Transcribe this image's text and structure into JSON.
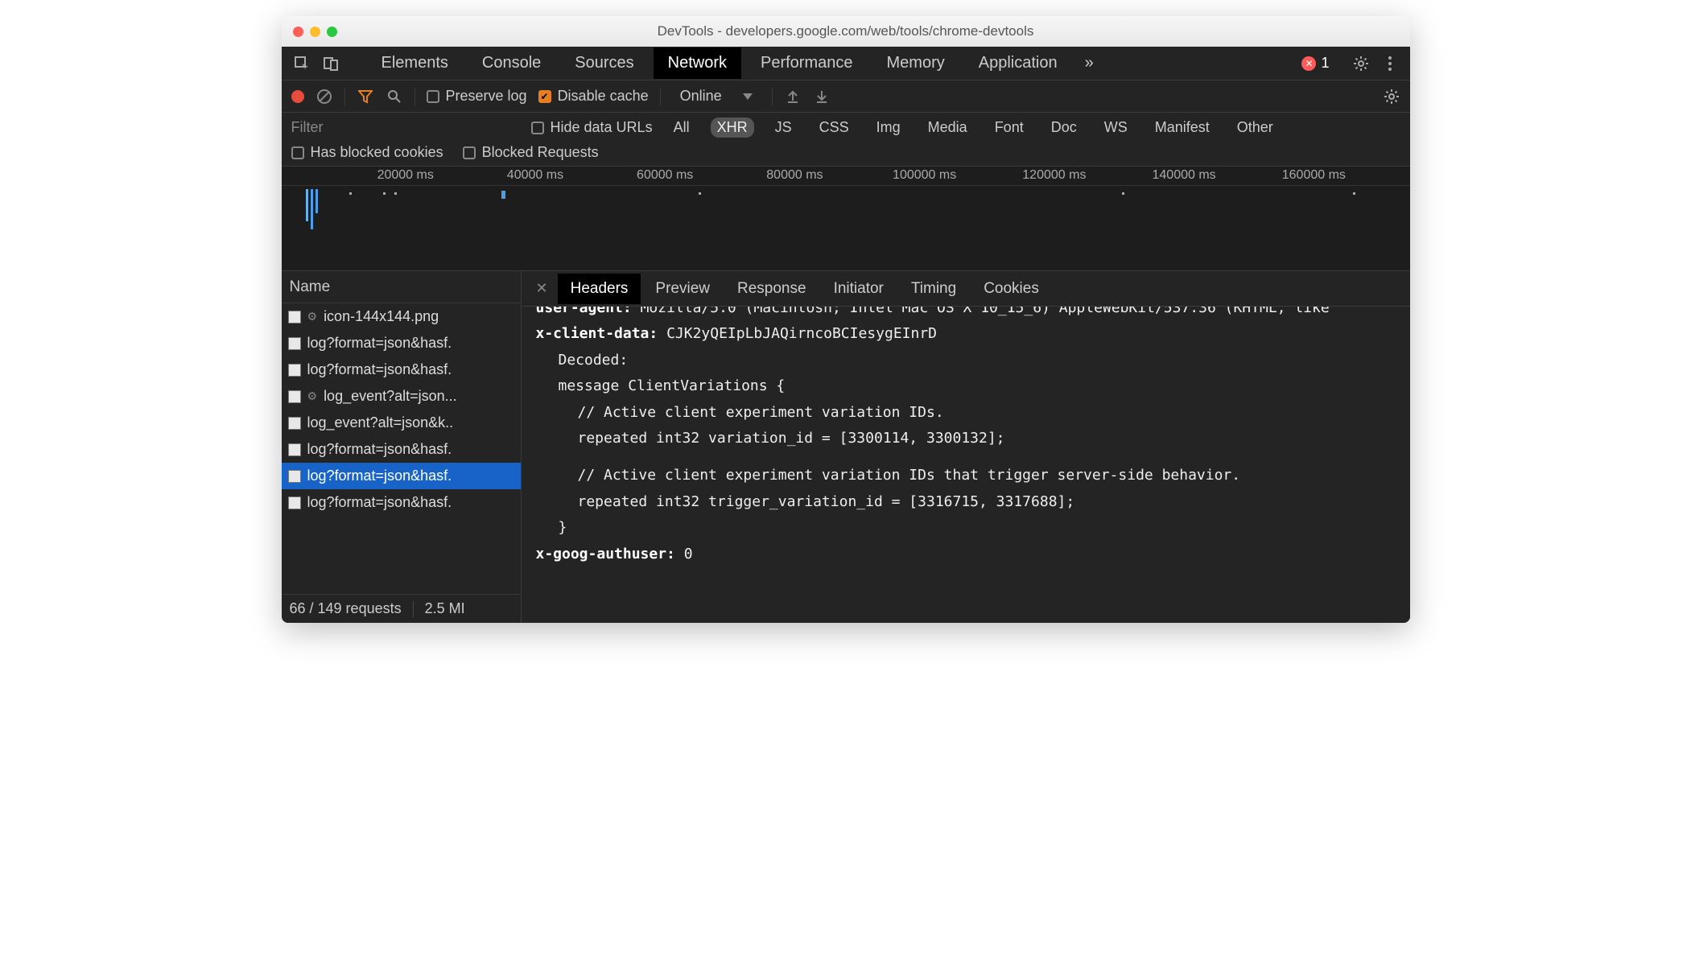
{
  "window": {
    "title": "DevTools - developers.google.com/web/tools/chrome-devtools"
  },
  "mainTabs": {
    "items": [
      "Elements",
      "Console",
      "Sources",
      "Network",
      "Performance",
      "Memory",
      "Application"
    ],
    "moreGlyph": "»",
    "activeIndex": 3,
    "errorCount": "1"
  },
  "networkToolbar": {
    "preserveLog": {
      "label": "Preserve log",
      "checked": false
    },
    "disableCache": {
      "label": "Disable cache",
      "checked": true
    },
    "throttling": "Online"
  },
  "filter": {
    "placeholder": "Filter",
    "hideDataUrls": {
      "label": "Hide data URLs",
      "checked": false
    },
    "types": [
      "All",
      "XHR",
      "JS",
      "CSS",
      "Img",
      "Media",
      "Font",
      "Doc",
      "WS",
      "Manifest",
      "Other"
    ],
    "activeType": "XHR",
    "hasBlockedCookies": {
      "label": "Has blocked cookies",
      "checked": false
    },
    "blockedRequests": {
      "label": "Blocked Requests",
      "checked": false
    }
  },
  "timeline": {
    "ticks": [
      "20000 ms",
      "40000 ms",
      "60000 ms",
      "80000 ms",
      "100000 ms",
      "120000 ms",
      "140000 ms",
      "160000 ms"
    ]
  },
  "requests": {
    "header": "Name",
    "list": [
      {
        "name": "icon-144x144.png",
        "gear": true
      },
      {
        "name": "log?format=json&hasf.",
        "gear": false
      },
      {
        "name": "log?format=json&hasf.",
        "gear": false
      },
      {
        "name": "log_event?alt=json...",
        "gear": true
      },
      {
        "name": "log_event?alt=json&k..",
        "gear": false
      },
      {
        "name": "log?format=json&hasf.",
        "gear": false
      },
      {
        "name": "log?format=json&hasf.",
        "gear": false
      },
      {
        "name": "log?format=json&hasf.",
        "gear": false
      }
    ],
    "selectedIndex": 6,
    "footer": {
      "requests": "66 / 149 requests",
      "size": "2.5 MI"
    }
  },
  "detail": {
    "tabs": [
      "Headers",
      "Preview",
      "Response",
      "Initiator",
      "Timing",
      "Cookies"
    ],
    "activeIndex": 0,
    "headers": {
      "userAgentKey": "user-agent:",
      "userAgentValTrunc": "Mozilla/5.0 (Macintosh; Intel Mac OS X 10_15_6) AppleWebKit/537.36 (KHTML, like",
      "xClientDataKey": "x-client-data:",
      "xClientDataVal": "CJK2yQEIpLbJAQirncoBCIesygEInrD",
      "decoded": {
        "label": "Decoded:",
        "l1": "message ClientVariations {",
        "l2": "// Active client experiment variation IDs.",
        "l3": "repeated int32 variation_id = [3300114, 3300132];",
        "l4": "// Active client experiment variation IDs that trigger server-side behavior.",
        "l5": "repeated int32 trigger_variation_id = [3316715, 3317688];",
        "l6": "}"
      },
      "xGoogKey": "x-goog-authuser:",
      "xGoogVal": "0"
    }
  }
}
